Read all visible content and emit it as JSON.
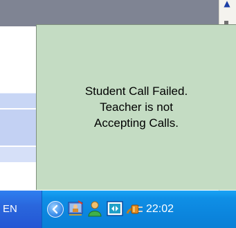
{
  "notification": {
    "lines": [
      "Student Call Failed.",
      "Teacher is not",
      "Accepting Calls."
    ]
  },
  "taskbar": {
    "language": "EN",
    "clock": "22:02",
    "tray_icons": [
      {
        "name": "show-hidden-icons-icon"
      },
      {
        "name": "teacher-app-icon"
      },
      {
        "name": "user-green-icon"
      },
      {
        "name": "network-monitor-icon"
      },
      {
        "name": "power-plug-icon"
      }
    ]
  },
  "colors": {
    "popup_background": "#c4dcc3",
    "taskbar": "#1259d0",
    "tray": "#0b84dc"
  }
}
